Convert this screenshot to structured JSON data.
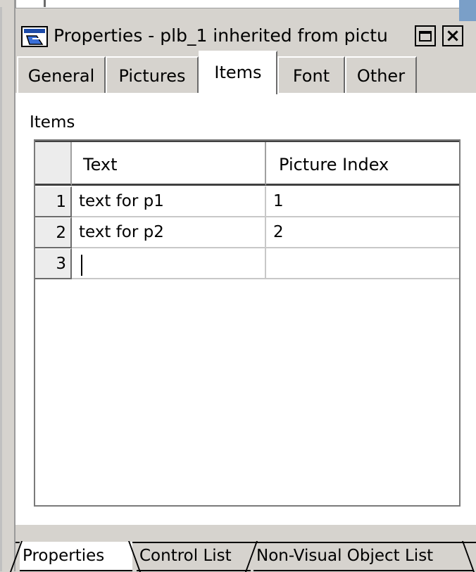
{
  "window": {
    "title": "Properties - plb_1 inherited  from  pictu",
    "title_icon": "properties-icon",
    "buttons": {
      "maximize": "maximize-icon",
      "close": "×"
    }
  },
  "tabs": [
    {
      "label": "General",
      "active": false
    },
    {
      "label": "Pictures",
      "active": false
    },
    {
      "label": "Items",
      "active": true
    },
    {
      "label": "Font",
      "active": false
    },
    {
      "label": "Other",
      "active": false
    }
  ],
  "items_section": {
    "label": "Items",
    "columns": [
      "Text",
      "Picture Index"
    ],
    "rows": [
      {
        "num": "1",
        "text": "text for p1",
        "picture_index": "1"
      },
      {
        "num": "2",
        "text": "text for p2",
        "picture_index": "2"
      },
      {
        "num": "3",
        "text": "",
        "picture_index": ""
      }
    ]
  },
  "bottom_tabs": [
    {
      "label": "Properties",
      "active": true
    },
    {
      "label": "Control List",
      "active": false
    },
    {
      "label": "Non-Visual Object List",
      "active": false
    }
  ],
  "colors": {
    "chrome": "#d6d3ce",
    "panel": "#ffffff",
    "accent": "#7a9fc8"
  }
}
